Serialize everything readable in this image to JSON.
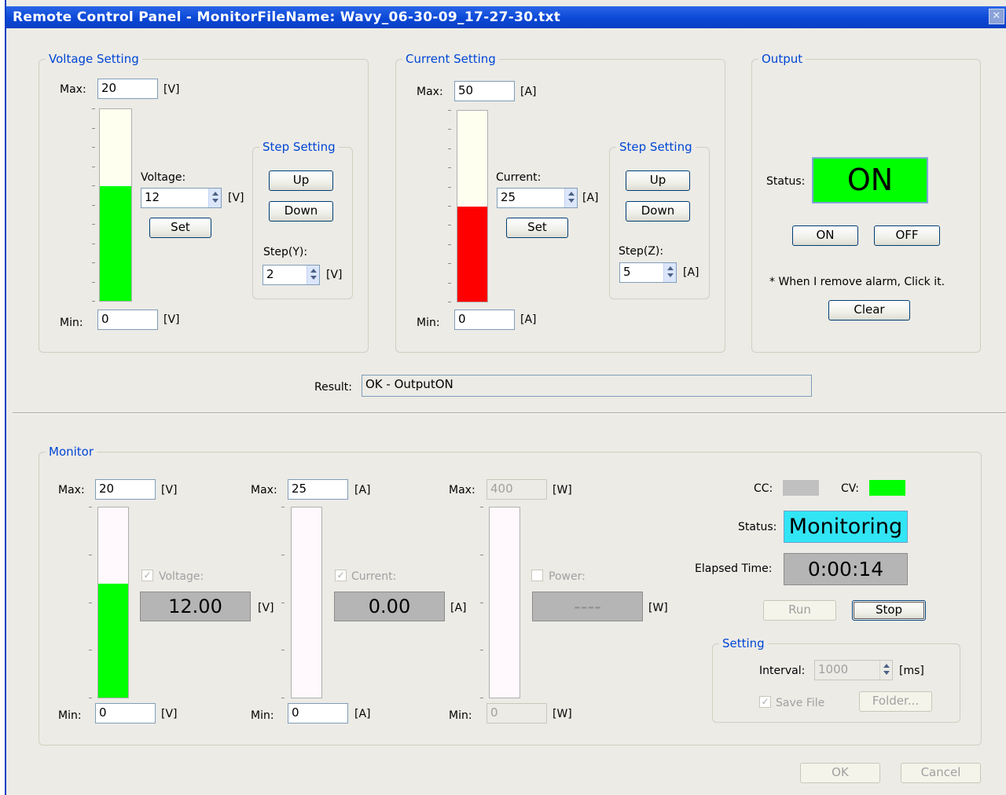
{
  "window": {
    "title": "Remote Control Panel - MonitorFileName: Wavy_06-30-09_17-27-30.txt"
  },
  "colors": {
    "green": "#00ff00",
    "red": "#ff0000",
    "cyan": "#32e5f5",
    "gray": "#b5b5b5"
  },
  "voltage_setting": {
    "title": "Voltage Setting",
    "max_label": "Max:",
    "max_value": "20",
    "unit": "[V]",
    "min_label": "Min:",
    "min_value": "0",
    "value_label": "Voltage:",
    "value": "12",
    "set_label": "Set",
    "level": 0.6,
    "step": {
      "title": "Step Setting",
      "up_label": "Up",
      "down_label": "Down",
      "step_label": "Step(Y):",
      "step_value": "2",
      "unit": "[V]"
    }
  },
  "current_setting": {
    "title": "Current Setting",
    "max_label": "Max:",
    "max_value": "50",
    "unit": "[A]",
    "min_label": "Min:",
    "min_value": "0",
    "value_label": "Current:",
    "value": "25",
    "set_label": "Set",
    "level": 0.5,
    "step": {
      "title": "Step Setting",
      "up_label": "Up",
      "down_label": "Down",
      "step_label": "Step(Z):",
      "step_value": "5",
      "unit": "[A]"
    }
  },
  "output": {
    "title": "Output",
    "status_label": "Status:",
    "status_value": "ON",
    "on_label": "ON",
    "off_label": "OFF",
    "note": "* When I remove alarm, Click it.",
    "clear_label": "Clear"
  },
  "result": {
    "label": "Result:",
    "value": "OK - OutputON"
  },
  "monitor": {
    "title": "Monitor",
    "voltage": {
      "max_label": "Max:",
      "max_value": "20",
      "min_label": "Min:",
      "min_value": "0",
      "unit": "[V]",
      "check_label": "Voltage:",
      "reading": "12.00",
      "level": 0.6,
      "checked": true
    },
    "current": {
      "max_label": "Max:",
      "max_value": "25",
      "min_label": "Min:",
      "min_value": "0",
      "unit": "[A]",
      "check_label": "Current:",
      "reading": "0.00",
      "level": 0,
      "checked": true
    },
    "power": {
      "max_label": "Max:",
      "max_value": "400",
      "min_label": "Min:",
      "min_value": "0",
      "unit": "[W]",
      "check_label": "Power:",
      "reading": "----",
      "level": 0,
      "checked": false
    },
    "cc_label": "CC:",
    "cv_label": "CV:",
    "status_label": "Status:",
    "status_value": "Monitoring",
    "elapsed_label": "Elapsed Time:",
    "elapsed_value": "0:00:14",
    "run_label": "Run",
    "stop_label": "Stop",
    "setting": {
      "title": "Setting",
      "interval_label": "Interval:",
      "interval_value": "1000",
      "interval_unit": "[ms]",
      "save_label": "Save File",
      "folder_label": "Folder..."
    }
  },
  "dialog": {
    "ok_label": "OK",
    "cancel_label": "Cancel"
  }
}
